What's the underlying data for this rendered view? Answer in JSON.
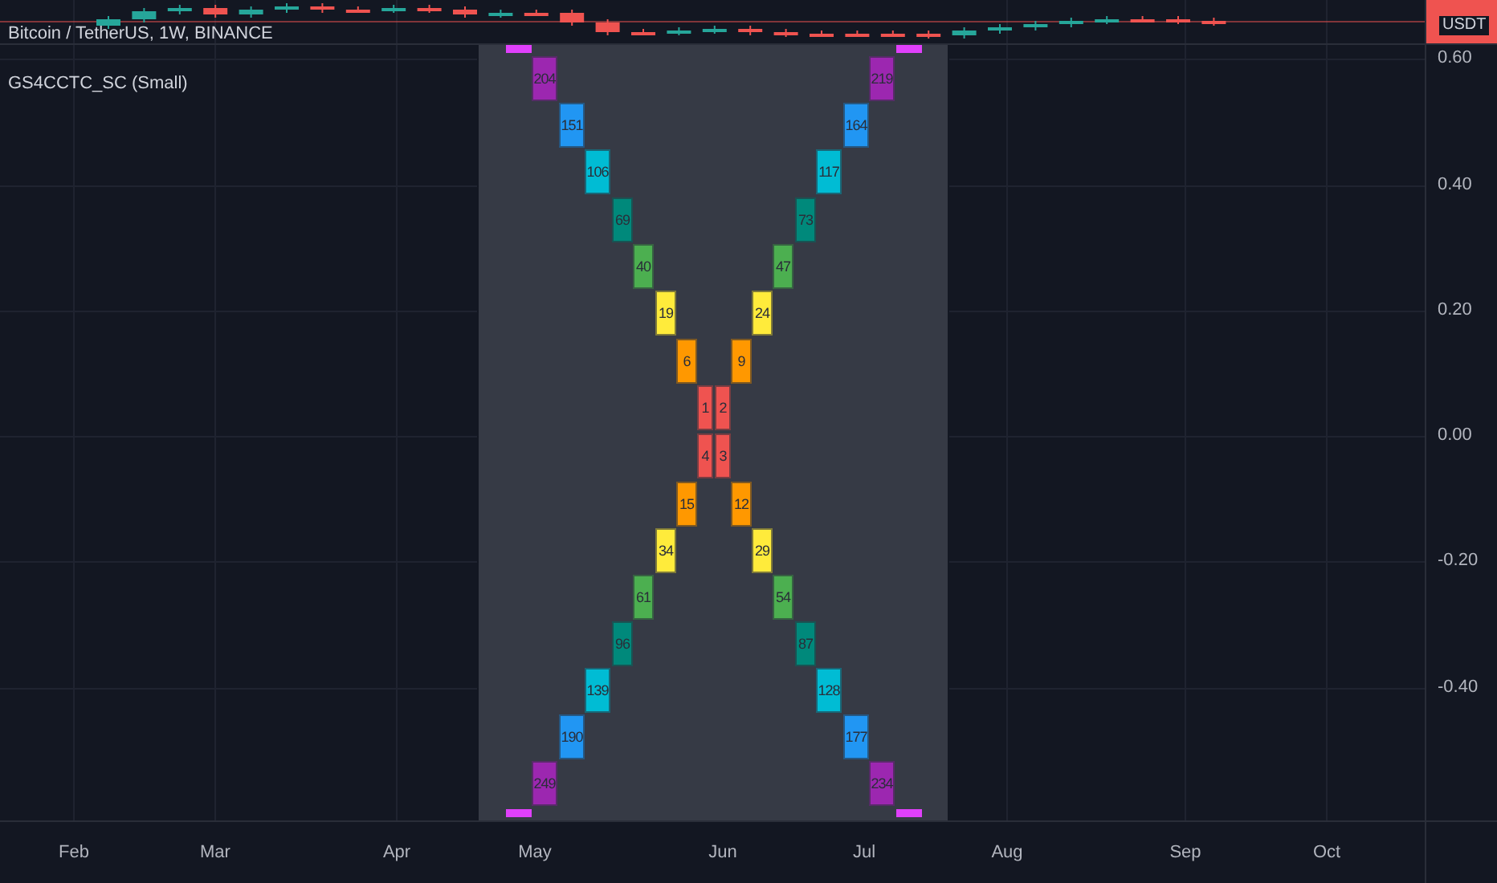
{
  "main_pane": {
    "legend": "Bitcoin / TetherUS, 1W, BINANCE",
    "currency_tag": "USDT"
  },
  "indicator": {
    "name": "GS4CCTC_SC (Small)",
    "arms": [
      {
        "kind": "upper_left",
        "cells": [
          {
            "label": "204",
            "color": "#9c27b0"
          },
          {
            "label": "151",
            "color": "#2196f3"
          },
          {
            "label": "106",
            "color": "#00bcd4"
          },
          {
            "label": "69",
            "color": "#00897b"
          },
          {
            "label": "40",
            "color": "#4caf50"
          },
          {
            "label": "19",
            "color": "#ffeb3b"
          },
          {
            "label": "6",
            "color": "#ff9800"
          }
        ]
      },
      {
        "kind": "upper_right",
        "cells": [
          {
            "label": "219",
            "color": "#9c27b0"
          },
          {
            "label": "164",
            "color": "#2196f3"
          },
          {
            "label": "117",
            "color": "#00bcd4"
          },
          {
            "label": "73",
            "color": "#00897b"
          },
          {
            "label": "47",
            "color": "#4caf50"
          },
          {
            "label": "24",
            "color": "#ffeb3b"
          },
          {
            "label": "9",
            "color": "#ff9800"
          }
        ]
      },
      {
        "kind": "lower_left",
        "cells": [
          {
            "label": "249",
            "color": "#9c27b0"
          },
          {
            "label": "190",
            "color": "#2196f3"
          },
          {
            "label": "139",
            "color": "#00bcd4"
          },
          {
            "label": "96",
            "color": "#00897b"
          },
          {
            "label": "61",
            "color": "#4caf50"
          },
          {
            "label": "34",
            "color": "#ffeb3b"
          },
          {
            "label": "15",
            "color": "#ff9800"
          }
        ]
      },
      {
        "kind": "lower_right",
        "cells": [
          {
            "label": "234",
            "color": "#9c27b0"
          },
          {
            "label": "177",
            "color": "#2196f3"
          },
          {
            "label": "128",
            "color": "#00bcd4"
          },
          {
            "label": "87",
            "color": "#00897b"
          },
          {
            "label": "54",
            "color": "#4caf50"
          },
          {
            "label": "29",
            "color": "#ffeb3b"
          },
          {
            "label": "12",
            "color": "#ff9800"
          }
        ]
      }
    ],
    "center": [
      {
        "label": "1",
        "color": "#ef5350"
      },
      {
        "label": "2",
        "color": "#ef5350"
      },
      {
        "label": "4",
        "color": "#ef5350"
      },
      {
        "label": "3",
        "color": "#ef5350"
      }
    ],
    "end_marks": [
      {
        "color": "#e040fb"
      },
      {
        "color": "#e040fb"
      },
      {
        "color": "#e040fb"
      },
      {
        "color": "#e040fb"
      }
    ]
  },
  "y_axis_labels": [
    "0.60",
    "0.40",
    "0.20",
    "0.00",
    "-0.20",
    "-0.40"
  ],
  "time_axis_labels": [
    "Feb",
    "Mar",
    "Apr",
    "May",
    "Jun",
    "Jul",
    "Aug",
    "Sep",
    "Oct"
  ]
}
